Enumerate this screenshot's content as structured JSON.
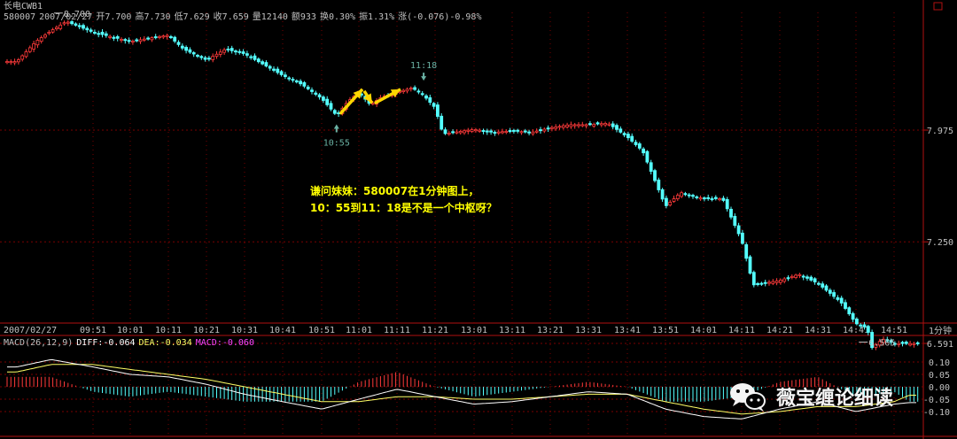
{
  "header": {
    "title": "长电CWB1",
    "code": "580007",
    "date": "2007/02/27",
    "open": "开7.700",
    "high": "高7.730",
    "low": "低7.629",
    "close": "收7.659",
    "volume": "量12140",
    "amount": "额933",
    "turnover": "换0.30%",
    "amplitude": "振1.31%",
    "change": "涨(-0.076)-0.98%"
  },
  "macd_header": {
    "params": "MACD(26,12,9)",
    "diff": "DIFF:-0.064",
    "dea": "DEA:-0.034",
    "macd": "MACD:-0.060"
  },
  "annotation": {
    "line1": "谦问妹妹：580007在1分钟图上，",
    "line2": "10：55到11：18是不是一个中枢呀？"
  },
  "watermark": {
    "text": "薇宝缠论细读",
    "icon": "wechat-icon"
  },
  "period_label": "1分钟",
  "colors": {
    "up": "#ff3a3a",
    "down": "#54ffff",
    "grid": "#7a0000",
    "diff": "#ffffff",
    "dea": "#ffff66",
    "arrow": "#ffd700",
    "mark": "#6ab2a4"
  },
  "chart_data": [
    {
      "type": "candlestick",
      "title": "",
      "xlabel": "",
      "ylabel": "",
      "x_ticks": [
        "2007/02/27",
        "09:51",
        "10:01",
        "10:11",
        "10:21",
        "10:31",
        "10:41",
        "10:51",
        "11:01",
        "11:11",
        "11:21",
        "13:01",
        "13:11",
        "13:21",
        "13:31",
        "13:41",
        "13:51",
        "14:01",
        "14:11",
        "14:21",
        "14:31",
        "14:41",
        "14:51"
      ],
      "y_ticks": [
        6.591,
        7.25,
        7.975
      ],
      "ylim": [
        6.5,
        8.75
      ],
      "price_marks": [
        {
          "time": "09:44",
          "value": 8.7,
          "label": "8.700"
        },
        {
          "time": "14:45",
          "value": 6.565,
          "label": "6.565"
        }
      ],
      "time_marks": [
        {
          "time": "10:55",
          "label": "10:55"
        },
        {
          "time": "11:18",
          "label": "11:18"
        }
      ],
      "series": [
        {
          "x": [
            "09:31",
            "09:36",
            "09:40",
            "09:44",
            "09:51",
            "10:01",
            "10:08",
            "10:11",
            "10:15",
            "10:21",
            "10:26",
            "10:31",
            "10:36",
            "10:41",
            "10:46",
            "10:51",
            "10:55",
            "10:58",
            "11:01",
            "11:04",
            "11:07",
            "11:11",
            "11:15",
            "11:18",
            "11:21",
            "11:23",
            "13:01",
            "13:06",
            "13:11",
            "13:16",
            "13:21",
            "13:26",
            "13:31",
            "13:36",
            "13:41",
            "13:45",
            "13:51",
            "13:55",
            "14:01",
            "14:06",
            "14:11",
            "14:14",
            "14:21",
            "14:26",
            "14:31",
            "14:34",
            "14:37",
            "14:41",
            "14:44",
            "14:45",
            "14:48",
            "14:51",
            "14:55"
          ],
          "values": [
            8.42,
            8.55,
            8.62,
            8.68,
            8.61,
            8.55,
            8.58,
            8.59,
            8.5,
            8.43,
            8.5,
            8.47,
            8.4,
            8.33,
            8.27,
            8.18,
            8.07,
            8.16,
            8.22,
            8.14,
            8.19,
            8.22,
            8.25,
            8.2,
            8.12,
            7.95,
            7.98,
            7.96,
            7.97,
            7.96,
            7.99,
            8.01,
            8.01,
            8.02,
            7.93,
            7.84,
            7.48,
            7.57,
            7.53,
            7.53,
            7.26,
            6.97,
            7.0,
            7.04,
            6.98,
            6.92,
            6.86,
            6.72,
            6.69,
            6.56,
            6.62,
            6.59,
            6.59
          ]
        }
      ]
    },
    {
      "type": "line",
      "title": "",
      "y_ticks": [
        0.1,
        0.05,
        0.0,
        -0.05,
        -0.1
      ],
      "ylim": [
        -0.125,
        0.125
      ],
      "series": [
        {
          "name": "DIFF",
          "x": [
            "09:31",
            "09:40",
            "09:51",
            "10:01",
            "10:11",
            "10:21",
            "10:31",
            "10:41",
            "10:51",
            "11:01",
            "11:11",
            "11:21",
            "13:01",
            "13:11",
            "13:21",
            "13:31",
            "13:41",
            "13:51",
            "14:01",
            "14:11",
            "14:21",
            "14:31",
            "14:41",
            "14:51",
            "14:55"
          ],
          "values": [
            0.08,
            0.11,
            0.08,
            0.05,
            0.04,
            0.01,
            -0.03,
            -0.06,
            -0.09,
            -0.05,
            -0.01,
            -0.04,
            -0.07,
            -0.06,
            -0.04,
            -0.02,
            -0.03,
            -0.09,
            -0.12,
            -0.13,
            -0.09,
            -0.06,
            -0.1,
            -0.07,
            -0.064
          ]
        },
        {
          "name": "DEA",
          "x": [
            "09:31",
            "09:40",
            "09:51",
            "10:01",
            "10:11",
            "10:21",
            "10:31",
            "10:41",
            "10:51",
            "11:01",
            "11:11",
            "11:21",
            "13:01",
            "13:11",
            "13:21",
            "13:31",
            "13:41",
            "13:51",
            "14:01",
            "14:11",
            "14:21",
            "14:31",
            "14:41",
            "14:51",
            "14:55"
          ],
          "values": [
            0.06,
            0.09,
            0.09,
            0.07,
            0.05,
            0.03,
            0.0,
            -0.03,
            -0.06,
            -0.06,
            -0.04,
            -0.04,
            -0.05,
            -0.05,
            -0.04,
            -0.03,
            -0.03,
            -0.06,
            -0.09,
            -0.11,
            -0.1,
            -0.08,
            -0.08,
            -0.06,
            -0.034
          ]
        }
      ]
    }
  ]
}
